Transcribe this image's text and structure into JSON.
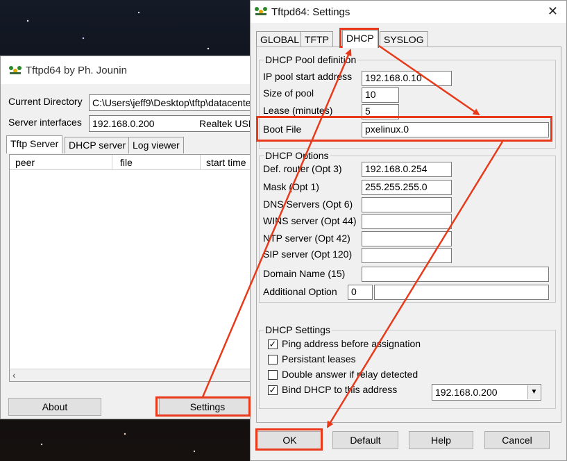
{
  "main_window": {
    "title": "Tftpd64 by Ph. Jounin",
    "current_directory_label": "Current Directory",
    "current_directory_value": "C:\\Users\\jeff9\\Desktop\\tftp\\datacente",
    "server_interfaces_label": "Server interfaces",
    "server_interfaces_value": "192.168.0.200",
    "server_interfaces_adapter": "Realtek USI",
    "tabs": [
      "Tftp Server",
      "DHCP server",
      "Log viewer"
    ],
    "columns": [
      "peer",
      "file",
      "start time"
    ],
    "about_button": "About",
    "settings_button": "Settings"
  },
  "settings_dialog": {
    "title": "Tftpd64: Settings",
    "tabs": [
      "GLOBAL",
      "TFTP",
      "DHCP",
      "SYSLOG"
    ],
    "active_tab": "DHCP",
    "pool": {
      "legend": "DHCP Pool definition",
      "ip_start_label": "IP pool start address",
      "ip_start_value": "192.168.0.10",
      "pool_size_label": "Size of pool",
      "pool_size_value": "10",
      "lease_label": "Lease (minutes)",
      "lease_value": "5",
      "boot_file_label": "Boot File",
      "boot_file_value": "pxelinux.0"
    },
    "options": {
      "legend": "DHCP Options",
      "router_label": "Def. router (Opt 3)",
      "router_value": "192.168.0.254",
      "mask_label": "Mask (Opt 1)",
      "mask_value": "255.255.255.0",
      "dns_label": "DNS Servers (Opt 6)",
      "wins_label": "WINS server (Opt 44)",
      "ntp_label": "NTP server (Opt 42)",
      "sip_label": "SIP server (Opt 120)",
      "domain_label": "Domain Name (15)",
      "additional_label": "Additional Option",
      "additional_code_value": "0"
    },
    "settings": {
      "legend": "DHCP Settings",
      "ping_label": "Ping address before assignation",
      "ping_checked": true,
      "persistant_label": "Persistant leases",
      "persistant_checked": false,
      "double_label": "Double answer if relay detected",
      "double_checked": false,
      "bind_label": "Bind DHCP to this address",
      "bind_checked": true,
      "bind_address": "192.168.0.200"
    },
    "buttons": {
      "ok": "OK",
      "default": "Default",
      "help": "Help",
      "cancel": "Cancel"
    }
  },
  "annotation_color": "#e83a1a"
}
